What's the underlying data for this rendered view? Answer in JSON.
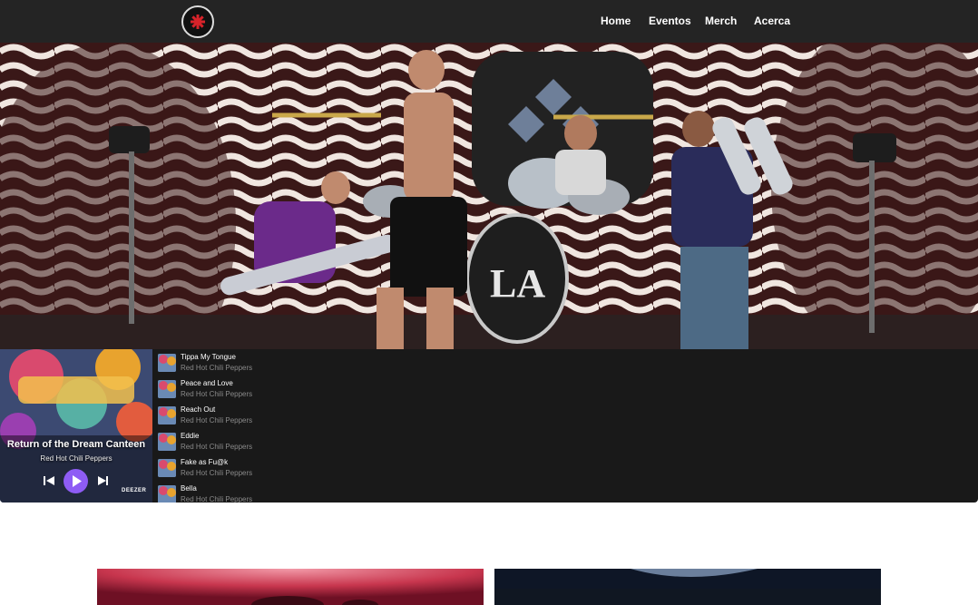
{
  "header": {
    "logo_name": "rhcp-logo",
    "nav": [
      {
        "label": "Home"
      },
      {
        "label": "Eventos"
      },
      {
        "label": "Merch"
      },
      {
        "label": "Acerca"
      }
    ]
  },
  "player": {
    "album_title": "Return of the Dream Canteen",
    "artist": "Red Hot Chili Peppers",
    "provider": "DEEZER",
    "accent": "#8e5cf5",
    "tracks": [
      {
        "title": "Tippa My Tongue",
        "artist": "Red Hot Chili Peppers"
      },
      {
        "title": "Peace and Love",
        "artist": "Red Hot Chili Peppers"
      },
      {
        "title": "Reach Out",
        "artist": "Red Hot Chili Peppers"
      },
      {
        "title": "Eddie",
        "artist": "Red Hot Chili Peppers"
      },
      {
        "title": "Fake as Fu@k",
        "artist": "Red Hot Chili Peppers"
      },
      {
        "title": "Bella",
        "artist": "Red Hot Chili Peppers"
      }
    ]
  },
  "colors": {
    "header_bg": "#242424",
    "player_bg": "#191919"
  }
}
